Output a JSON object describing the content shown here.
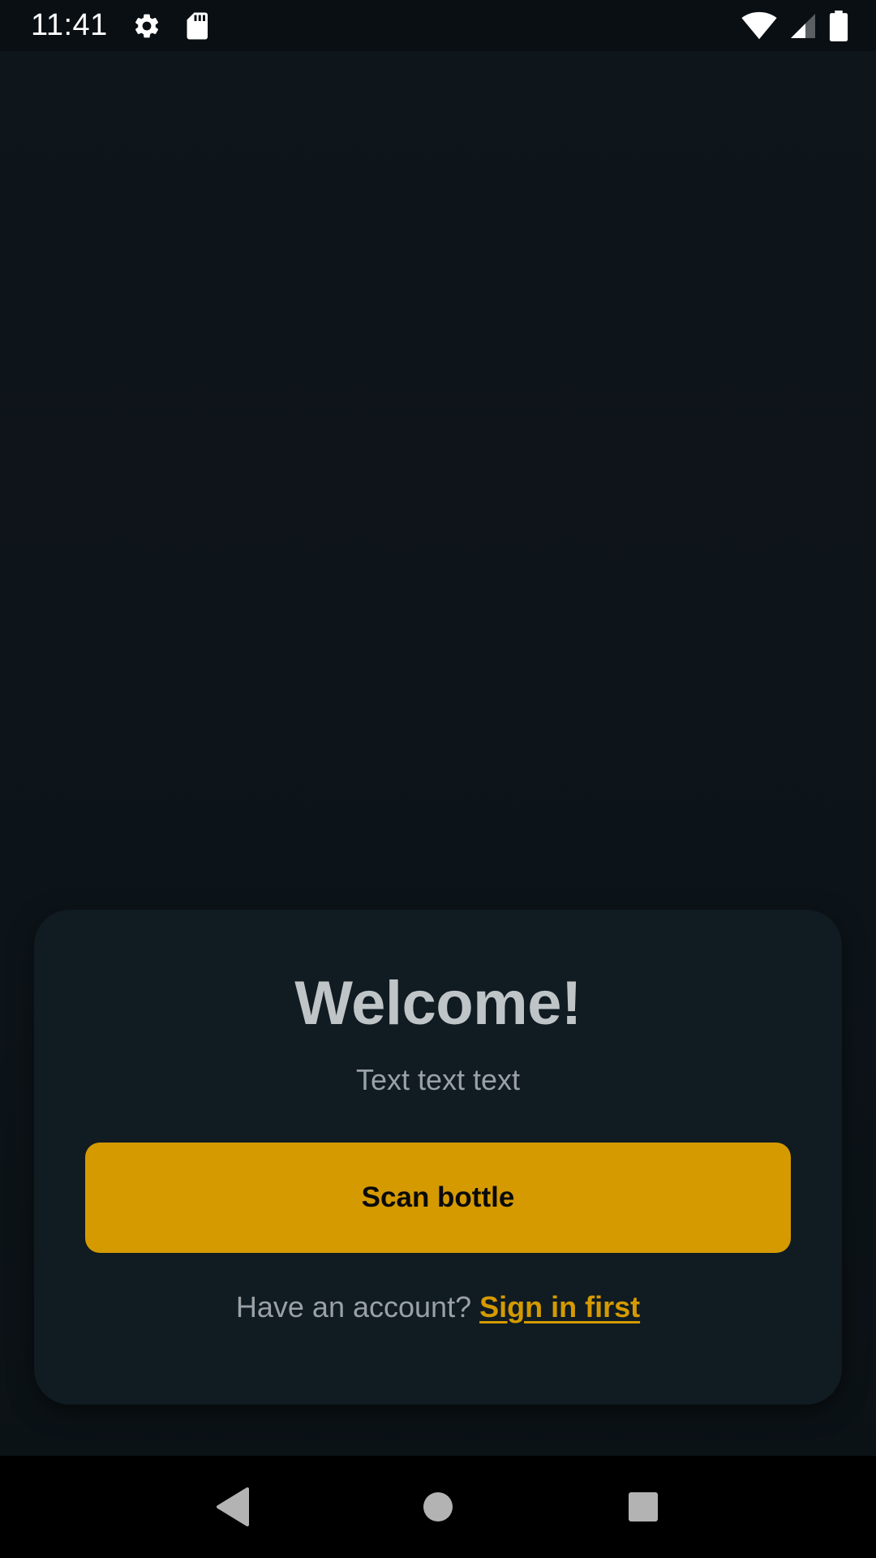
{
  "status_bar": {
    "time": "11:41",
    "icons": [
      "settings-icon",
      "sd-card-icon",
      "wifi-icon",
      "signal-icon",
      "battery-icon"
    ]
  },
  "welcome_card": {
    "title": "Welcome!",
    "subtitle": "Text text text",
    "scan_button_label": "Scan bottle",
    "account_prompt": "Have an account?",
    "sign_in_link": "Sign in first"
  },
  "nav_bar": {
    "icons": [
      "back-icon",
      "home-icon",
      "recents-icon"
    ]
  },
  "colors": {
    "accent": "#d49a00",
    "background": "#0d1318",
    "card": "#101b22",
    "title_text": "#bfc4c7",
    "secondary_text": "#9aa1a5"
  }
}
